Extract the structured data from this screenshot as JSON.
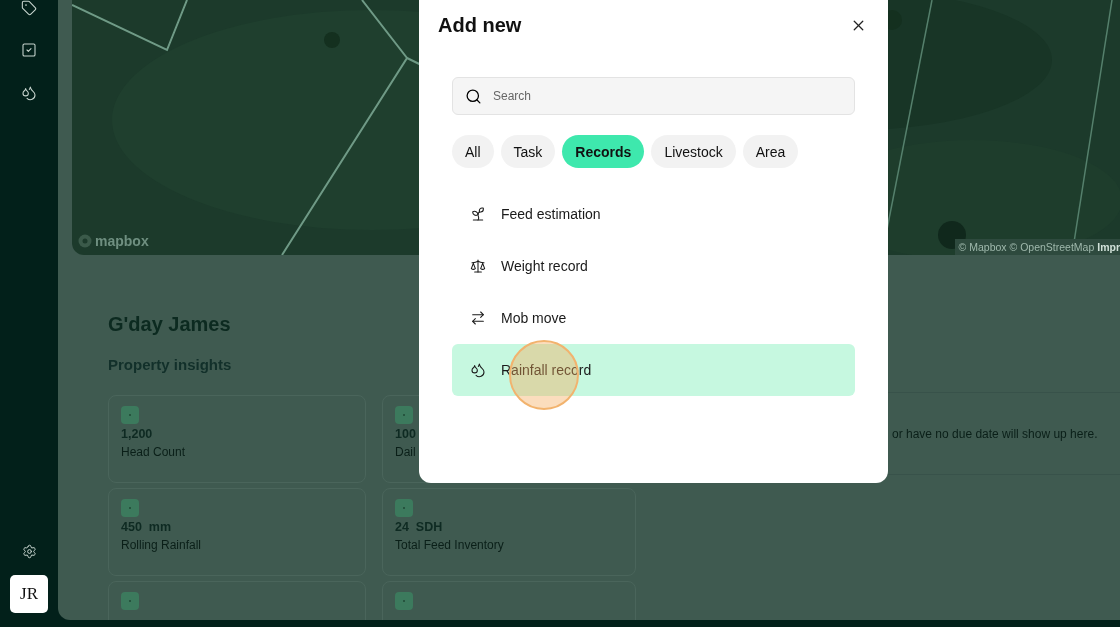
{
  "sidebar": {
    "avatar": "JR"
  },
  "map": {
    "kind": "picture",
    "logo": "mapbox",
    "attribution": "© Mapbox © OpenStreetMap",
    "attribution_link": "Impr"
  },
  "dashboard": {
    "greeting": "G'day James",
    "section_title": "Property insights",
    "stats": [
      {
        "kind": "stat",
        "value": "1,200",
        "label": "Head Count"
      },
      {
        "kind": "stat",
        "value": "100",
        "label": "Dail"
      },
      {
        "kind": "stat",
        "value": "450  mm",
        "label": "Rolling Rainfall"
      },
      {
        "kind": "stat",
        "value": "24  SDH",
        "label": "Total Feed Inventory"
      },
      {
        "kind": "cut"
      },
      {
        "kind": "cut"
      }
    ],
    "tasks_note": "or have no due date will show up here."
  },
  "modal": {
    "title": "Add new",
    "search": {
      "placeholder": "Search"
    },
    "filters": [
      {
        "label": "All",
        "selected": false
      },
      {
        "label": "Task",
        "selected": false
      },
      {
        "label": "Records",
        "selected": true
      },
      {
        "label": "Livestock",
        "selected": false
      },
      {
        "label": "Area",
        "selected": false
      }
    ],
    "items": [
      {
        "kind": "feed",
        "label": "Feed estimation",
        "selected": false
      },
      {
        "kind": "weight",
        "label": "Weight record",
        "selected": false
      },
      {
        "kind": "move",
        "label": "Mob move",
        "selected": false
      },
      {
        "kind": "rainfall",
        "label": "Rainfall record",
        "selected": true
      }
    ]
  }
}
